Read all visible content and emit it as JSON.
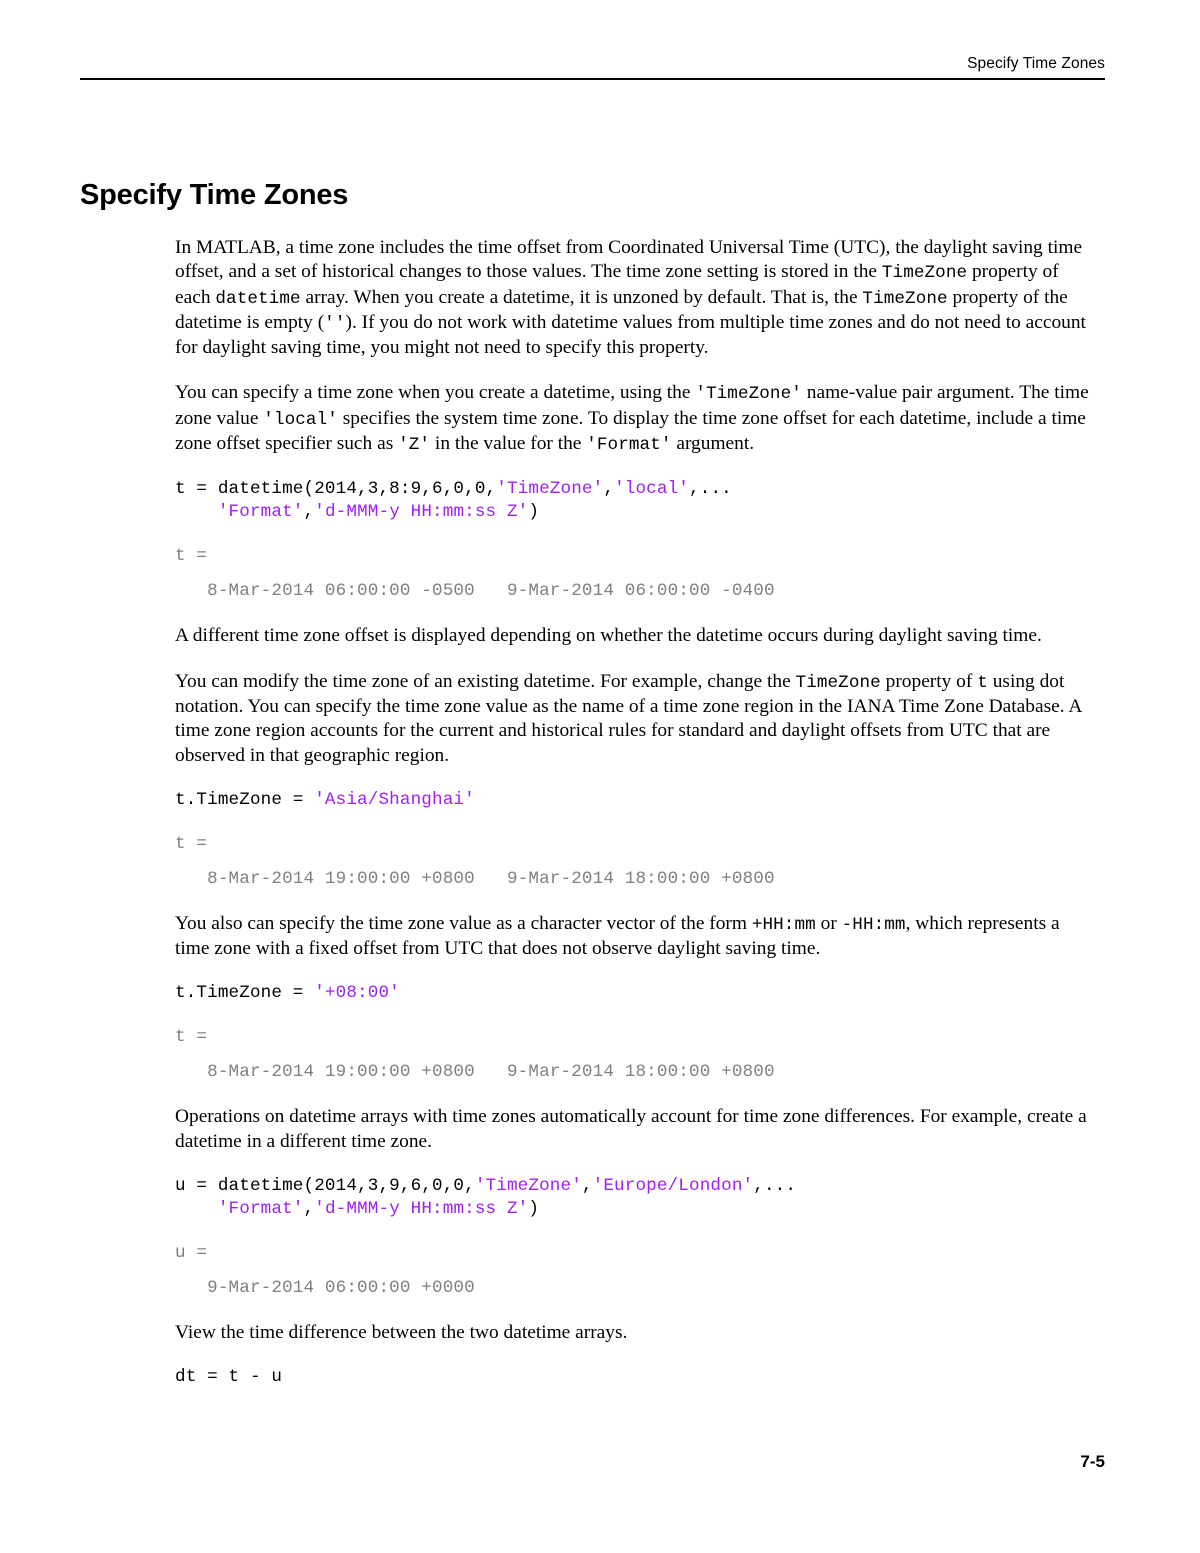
{
  "header": {
    "running_head": "Specify Time Zones"
  },
  "title": "Specify Time Zones",
  "footer": {
    "page_number": "7-5"
  },
  "colors": {
    "string_literal": "#a020f0",
    "output_text": "#808080",
    "body_text": "#000000",
    "rule": "#000000"
  },
  "body": {
    "p1": {
      "s1": "In MATLAB, a time zone includes the time offset from Coordinated Universal Time (UTC), the daylight saving time offset, and a set of historical changes to those values. The time zone setting is stored in the ",
      "c1": "TimeZone",
      "s2": " property of each ",
      "c2": "datetime",
      "s3": " array. When you create a datetime, it is unzoned by default. That is, the ",
      "c3": "TimeZone",
      "s4": " property of the datetime is empty (",
      "c4": "''",
      "s5": "). If you do not work with datetime values from multiple time zones and do not need to account for daylight saving time, you might not need to specify this property."
    },
    "p2": {
      "s1": "You can specify a time zone when you create a datetime, using the ",
      "c1": "'TimeZone'",
      "s2": " name-value pair argument. The time zone value ",
      "c2": "'local'",
      "s3": " specifies the system time zone. To display the time zone offset for each datetime, include a time zone offset specifier such as ",
      "c3": "'Z'",
      "s4": " in the value for the ",
      "c4": "'Format'",
      "s5": " argument."
    },
    "code1": {
      "line1_a": "t = datetime(2014,3,8:9,6,0,0,",
      "line1_str1": "'TimeZone'",
      "line1_b": ",",
      "line1_str2": "'local'",
      "line1_c": ",...",
      "line2_indent": "    ",
      "line2_str1": "'Format'",
      "line2_a": ",",
      "line2_str2": "'d-MMM-y HH:mm:ss Z'",
      "line2_b": ")"
    },
    "out1": {
      "name": "t =",
      "value": "   8-Mar-2014 06:00:00 -0500   9-Mar-2014 06:00:00 -0400"
    },
    "p3": {
      "s1": "A different time zone offset is displayed depending on whether the datetime occurs during daylight saving time."
    },
    "p4": {
      "s1": "You can modify the time zone of an existing datetime. For example, change the ",
      "c1": "TimeZone",
      "s2": " property of ",
      "c2": "t",
      "s3": " using dot notation. You can specify the time zone value as the name of a time zone region in the IANA Time Zone Database. A time zone region accounts for the current and historical rules for standard and daylight offsets from UTC that are observed in that geographic region."
    },
    "code2": {
      "line1_a": "t.TimeZone = ",
      "line1_str1": "'Asia/Shanghai'"
    },
    "out2": {
      "name": "t =",
      "value": "   8-Mar-2014 19:00:00 +0800   9-Mar-2014 18:00:00 +0800"
    },
    "p5": {
      "s1": "You also can specify the time zone value as a character vector of the form ",
      "c1": "+HH:mm",
      "s2": " or ",
      "c2": "-HH:mm",
      "s3": ", which represents a time zone with a fixed offset from UTC that does not observe daylight saving time."
    },
    "code3": {
      "line1_a": "t.TimeZone = ",
      "line1_str1": "'+08:00'"
    },
    "out3": {
      "name": "t =",
      "value": "   8-Mar-2014 19:00:00 +0800   9-Mar-2014 18:00:00 +0800"
    },
    "p6": {
      "s1": "Operations on datetime arrays with time zones automatically account for time zone differences. For example, create a datetime in a different time zone."
    },
    "code4": {
      "line1_a": "u = datetime(2014,3,9,6,0,0,",
      "line1_str1": "'TimeZone'",
      "line1_b": ",",
      "line1_str2": "'Europe/London'",
      "line1_c": ",...",
      "line2_indent": "    ",
      "line2_str1": "'Format'",
      "line2_a": ",",
      "line2_str2": "'d-MMM-y HH:mm:ss Z'",
      "line2_b": ")"
    },
    "out4": {
      "name": "u =",
      "value": "   9-Mar-2014 06:00:00 +0000"
    },
    "p7": {
      "s1": "View the time difference between the two datetime arrays."
    },
    "code5": {
      "line1_a": "dt = t - u"
    }
  }
}
